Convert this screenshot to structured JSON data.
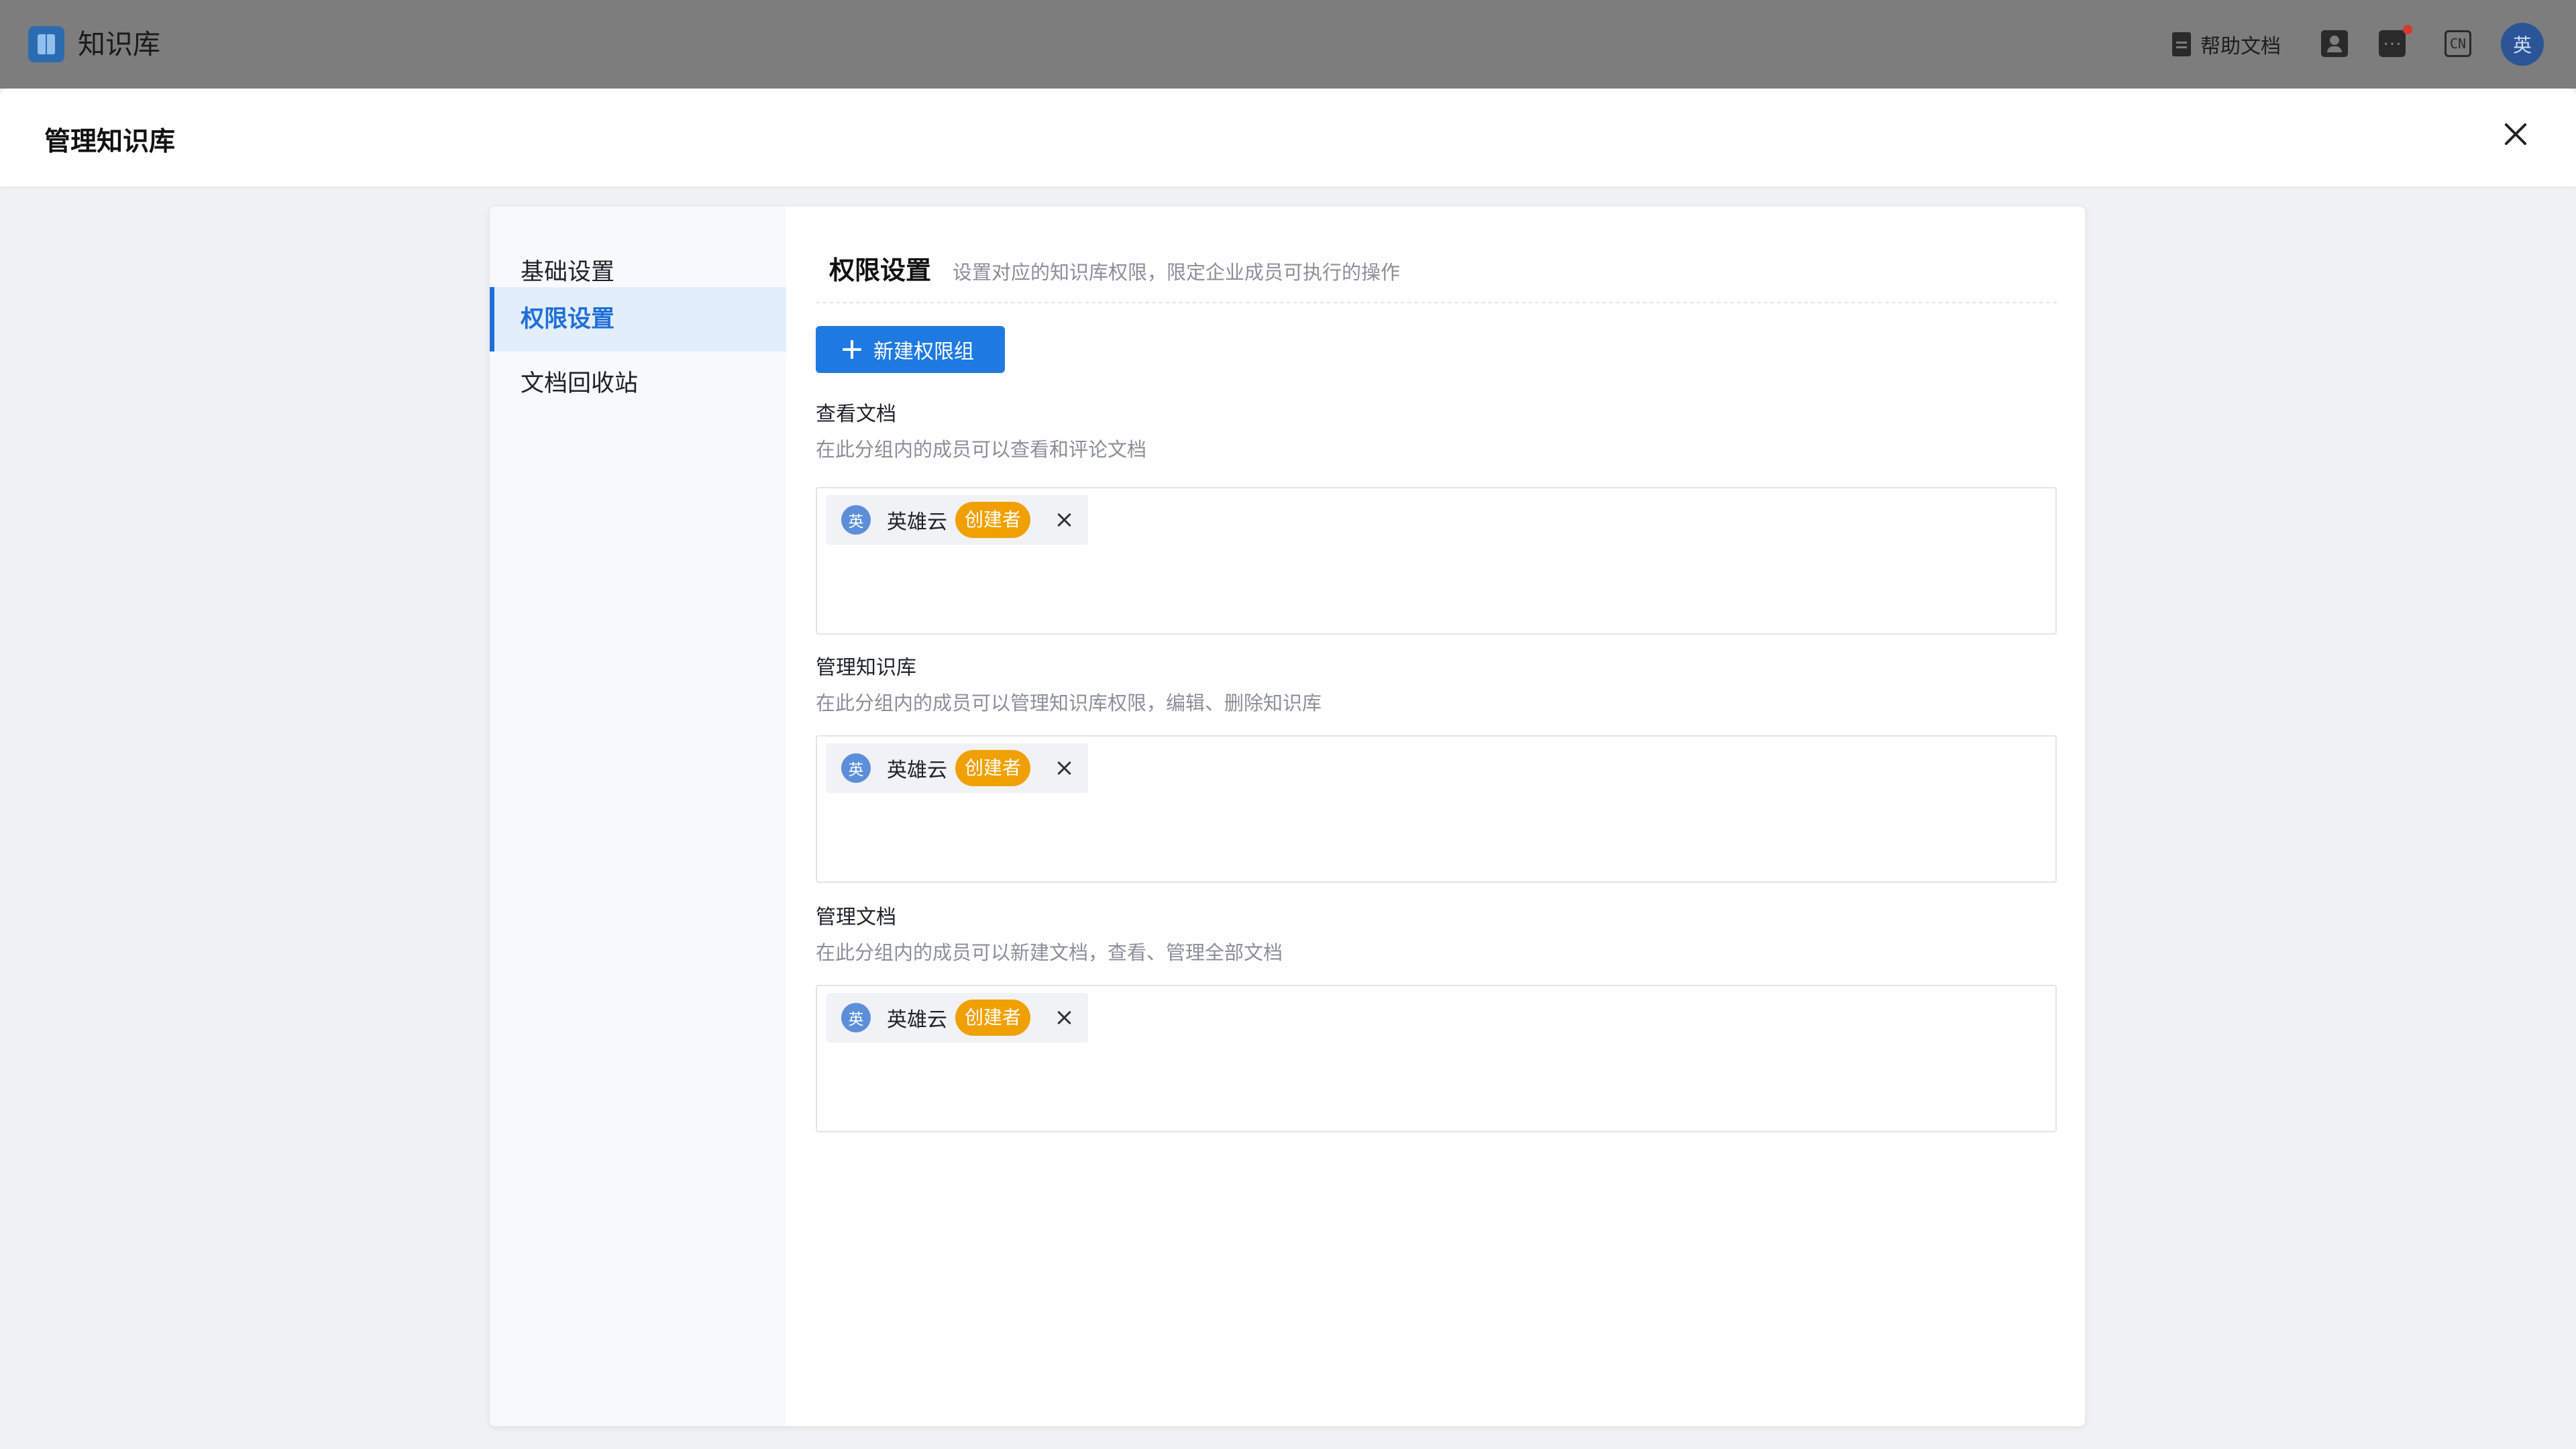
{
  "app": {
    "title": "知识库",
    "logo_icon": "book-icon"
  },
  "topbar": {
    "help_doc_label": "帮助文档",
    "language_label": "CN",
    "avatar_text": "英",
    "icons": [
      "doc-icon",
      "contacts-icon",
      "message-icon",
      "language-icon"
    ],
    "colors": {
      "notification_dot": "#d63a2f",
      "avatar_bg": "#2b5597"
    }
  },
  "modal": {
    "title": "管理知识库"
  },
  "sidebar": {
    "items": [
      {
        "label": "基础设置",
        "active": false
      },
      {
        "label": "权限设置",
        "active": true
      },
      {
        "label": "文档回收站",
        "active": false
      }
    ]
  },
  "permissions": {
    "title": "权限设置",
    "description": "设置对应的知识库权限，限定企业成员可执行的操作",
    "new_group_button": "新建权限组",
    "groups": [
      {
        "title": "查看文档",
        "description": "在此分组内的成员可以查看和评论文档",
        "members": [
          {
            "avatar": "英",
            "name": "英雄云",
            "badge": "创建者"
          }
        ]
      },
      {
        "title": "管理知识库",
        "description": "在此分组内的成员可以管理知识库权限，编辑、删除知识库",
        "members": [
          {
            "avatar": "英",
            "name": "英雄云",
            "badge": "创建者"
          }
        ]
      },
      {
        "title": "管理文档",
        "description": "在此分组内的成员可以新建文档，查看、管理全部文档",
        "members": [
          {
            "avatar": "英",
            "name": "英雄云",
            "badge": "创建者"
          }
        ]
      }
    ]
  },
  "colors": {
    "accent": "#1e7ae0",
    "badge": "#f0a000",
    "active_nav_bg": "#e3eefc"
  }
}
